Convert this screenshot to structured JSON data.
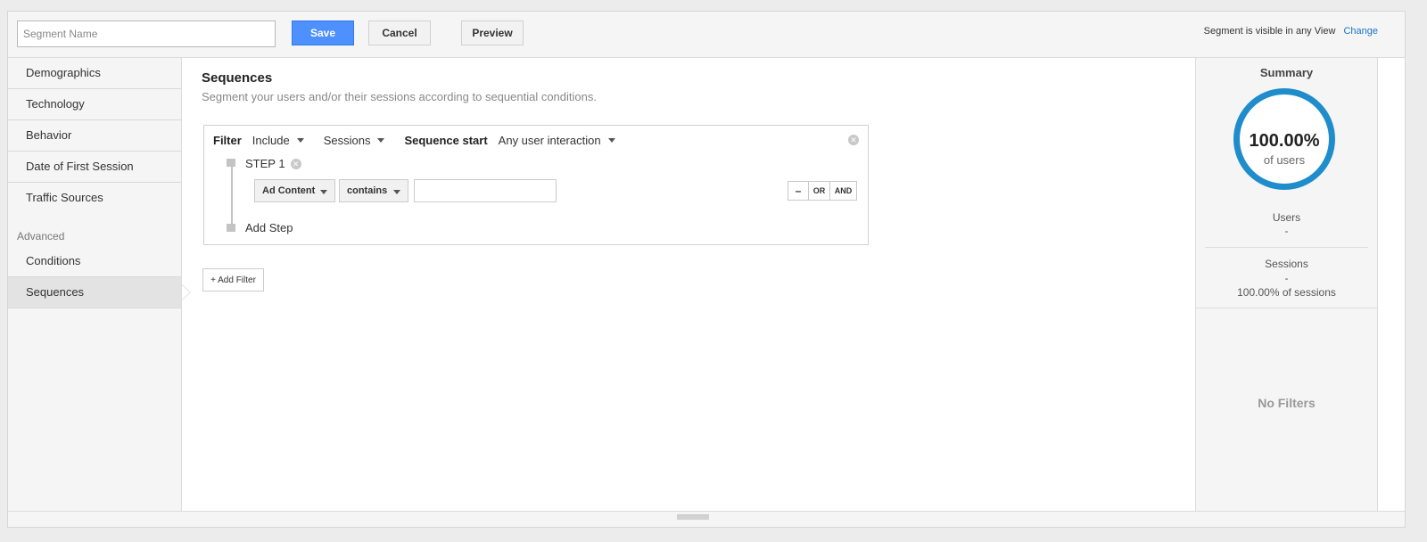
{
  "topbar": {
    "segment_name_placeholder": "Segment Name",
    "save_label": "Save",
    "cancel_label": "Cancel",
    "preview_label": "Preview",
    "visibility_text": "Segment is visible in any View",
    "change_label": "Change"
  },
  "nav": {
    "items": [
      "Demographics",
      "Technology",
      "Behavior",
      "Date of First Session",
      "Traffic Sources"
    ],
    "advanced_label": "Advanced",
    "advanced_items": [
      "Conditions",
      "Sequences"
    ],
    "active": "Sequences"
  },
  "main": {
    "title": "Sequences",
    "subtitle": "Segment your users and/or their sessions according to sequential conditions.",
    "filter": {
      "label": "Filter",
      "include": "Include",
      "scope": "Sessions",
      "sequence_start_label": "Sequence start",
      "sequence_start_value": "Any user interaction",
      "remove_icon": "✕",
      "step": {
        "label": "STEP 1",
        "remove_icon": "✕",
        "dimension": "Ad Content",
        "operator": "contains",
        "value": "",
        "minus_label": "–",
        "or_label": "OR",
        "and_label": "AND"
      },
      "add_step_label": "Add Step"
    },
    "add_filter_label": "+ Add Filter"
  },
  "summary": {
    "title": "Summary",
    "percent": "100.00%",
    "of_users": "of users",
    "users_label": "Users",
    "users_value": "-",
    "sessions_label": "Sessions",
    "sessions_value": "-",
    "sessions_pct": "100.00% of sessions",
    "no_filters": "No Filters"
  },
  "colors": {
    "primary_button": "#4d90fe",
    "ring": "#1f8dcb",
    "link": "#1a73c8"
  }
}
